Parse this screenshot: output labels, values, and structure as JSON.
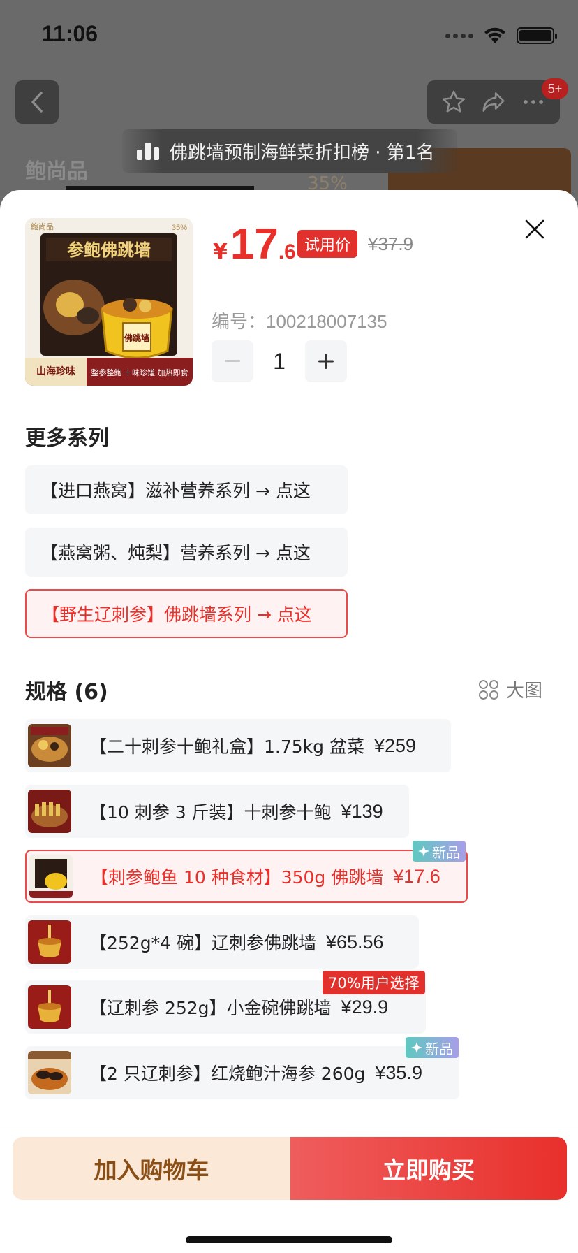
{
  "status_bar": {
    "time": "11:06"
  },
  "nav": {
    "badge": "5+"
  },
  "rank_banner": {
    "text": "佛跳墙预制海鲜菜折扣榜 · 第1名"
  },
  "background": {
    "brand": "鲍尚品",
    "discount": "35%"
  },
  "product": {
    "image_texts": {
      "brand": "鲍尚品",
      "title": "参鲍佛跳墙",
      "jar": "佛跳墙",
      "corner": "山海珍味",
      "pct": "35%",
      "bottom": "整参整鲍  十味珍馐  加热即食"
    },
    "price_symbol": "¥",
    "price_int": "17",
    "price_dec": ".6",
    "trial_label": "试用价",
    "original_price": "¥37.9",
    "code_label": "编号：",
    "code": "100218007135",
    "quantity": "1",
    "minus_icon": "minus-icon",
    "plus_icon": "plus-icon"
  },
  "series": {
    "title": "更多系列",
    "items": [
      {
        "label": "【进口燕窝】滋补营养系列 → 点这",
        "active": false
      },
      {
        "label": "【燕窝粥、炖梨】营养系列 → 点这",
        "active": false
      },
      {
        "label": "【野生辽刺参】佛跳墙系列 → 点这",
        "active": true
      }
    ]
  },
  "specs": {
    "title": "规格 (6)",
    "big_image_label": "大图",
    "items": [
      {
        "label": "【二十刺参十鲍礼盒】1.75kg 盆菜",
        "price": "¥259",
        "active": false
      },
      {
        "label": "【10 刺参 3 斤装】十刺参十鲍",
        "price": "¥139",
        "active": false
      },
      {
        "label": "【刺参鲍鱼 10 种食材】350g 佛跳墙",
        "price": "¥17.6",
        "active": true,
        "tag": "新品"
      },
      {
        "label": "【252g*4 碗】辽刺参佛跳墙",
        "price": "¥65.56",
        "active": false
      },
      {
        "label": "【辽刺参 252g】小金碗佛跳墙",
        "price": "¥29.9",
        "active": false,
        "tag": "70%用户选择"
      },
      {
        "label": "【2 只辽刺参】红烧鲍汁海参 260g",
        "price": "¥35.9",
        "active": false,
        "tag": "新品"
      }
    ]
  },
  "actions": {
    "add_to_cart": "加入购物车",
    "buy_now": "立即购买"
  },
  "colors": {
    "accent": "#e8302b",
    "cart_bg": "#fce8d6",
    "cart_text": "#8a4e17"
  }
}
